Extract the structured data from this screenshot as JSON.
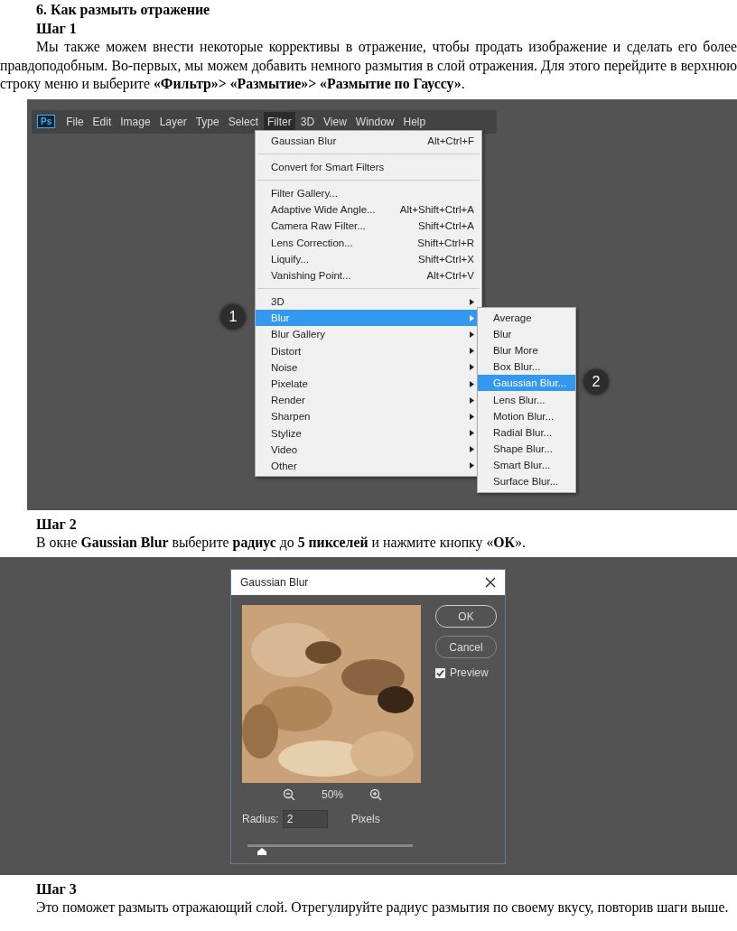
{
  "heading": "6.  Как размыть отражение",
  "step1": {
    "title": "Шаг 1",
    "text": "Мы также можем внести некоторые коррективы в отражение, чтобы продать изображение и сделать его более правдоподобным. Во-первых, мы можем добавить немного размытия в слой отражения. Для этого перейдите в верхнюю строку меню и выберите **«Фильтр»> «Размытие»> «Размытие по Гауссу»**."
  },
  "screenshot1": {
    "logo": "Ps",
    "menubar": [
      {
        "label": "File",
        "selected": false
      },
      {
        "label": "Edit",
        "selected": false
      },
      {
        "label": "Image",
        "selected": false
      },
      {
        "label": "Layer",
        "selected": false
      },
      {
        "label": "Type",
        "selected": false
      },
      {
        "label": "Select",
        "selected": false
      },
      {
        "label": "Filter",
        "selected": true
      },
      {
        "label": "3D",
        "selected": false
      },
      {
        "label": "View",
        "selected": false
      },
      {
        "label": "Window",
        "selected": false
      },
      {
        "label": "Help",
        "selected": false
      }
    ],
    "filter_menu": [
      [
        {
          "label": "Gaussian Blur",
          "shortcut": "Alt+Ctrl+F",
          "submenu": false,
          "selected": false
        }
      ],
      [
        {
          "label": "Convert for Smart Filters",
          "submenu": false,
          "selected": false
        }
      ],
      [
        {
          "label": "Filter Gallery...",
          "submenu": false,
          "selected": false
        },
        {
          "label": "Adaptive Wide Angle...",
          "shortcut": "Alt+Shift+Ctrl+A",
          "submenu": false,
          "selected": false
        },
        {
          "label": "Camera Raw Filter...",
          "shortcut": "Shift+Ctrl+A",
          "submenu": false,
          "selected": false
        },
        {
          "label": "Lens Correction...",
          "shortcut": "Shift+Ctrl+R",
          "submenu": false,
          "selected": false
        },
        {
          "label": "Liquify...",
          "shortcut": "Shift+Ctrl+X",
          "submenu": false,
          "selected": false
        },
        {
          "label": "Vanishing Point...",
          "shortcut": "Alt+Ctrl+V",
          "submenu": false,
          "selected": false
        }
      ],
      [
        {
          "label": "3D",
          "submenu": true,
          "selected": false
        },
        {
          "label": "Blur",
          "submenu": true,
          "selected": true
        },
        {
          "label": "Blur Gallery",
          "submenu": true,
          "selected": false
        },
        {
          "label": "Distort",
          "submenu": true,
          "selected": false
        },
        {
          "label": "Noise",
          "submenu": true,
          "selected": false
        },
        {
          "label": "Pixelate",
          "submenu": true,
          "selected": false
        },
        {
          "label": "Render",
          "submenu": true,
          "selected": false
        },
        {
          "label": "Sharpen",
          "submenu": true,
          "selected": false
        },
        {
          "label": "Stylize",
          "submenu": true,
          "selected": false
        },
        {
          "label": "Video",
          "submenu": true,
          "selected": false
        },
        {
          "label": "Other",
          "submenu": true,
          "selected": false
        }
      ]
    ],
    "blur_submenu": [
      {
        "label": "Average",
        "selected": false
      },
      {
        "label": "Blur",
        "selected": false
      },
      {
        "label": "Blur More",
        "selected": false
      },
      {
        "label": "Box Blur...",
        "selected": false
      },
      {
        "label": "Gaussian Blur...",
        "selected": true
      },
      {
        "label": "Lens Blur...",
        "selected": false
      },
      {
        "label": "Motion Blur...",
        "selected": false
      },
      {
        "label": "Radial Blur...",
        "selected": false
      },
      {
        "label": "Shape Blur...",
        "selected": false
      },
      {
        "label": "Smart Blur...",
        "selected": false
      },
      {
        "label": "Surface Blur...",
        "selected": false
      }
    ],
    "callouts": [
      "1",
      "2"
    ]
  },
  "step2": {
    "title": "Шаг 2",
    "text": "В окне **Gaussian Blur** выберите **радиус** до **5 пикселей** и нажмите кнопку «**ОК**»."
  },
  "dialog": {
    "title": "Gaussian Blur",
    "ok": "OK",
    "cancel": "Cancel",
    "preview": {
      "label": "Preview",
      "checked": true
    },
    "zoom": "50%",
    "radius_label": "Radius:",
    "radius_value": "2",
    "radius_unit": "Pixels",
    "slider": {
      "level": 0.09
    }
  },
  "step3": {
    "title": "Шаг 3",
    "text": "Это поможет размыть отражающий слой. Отрегулируйте радиус размытия по своему вкусу, повторив шаги выше."
  }
}
